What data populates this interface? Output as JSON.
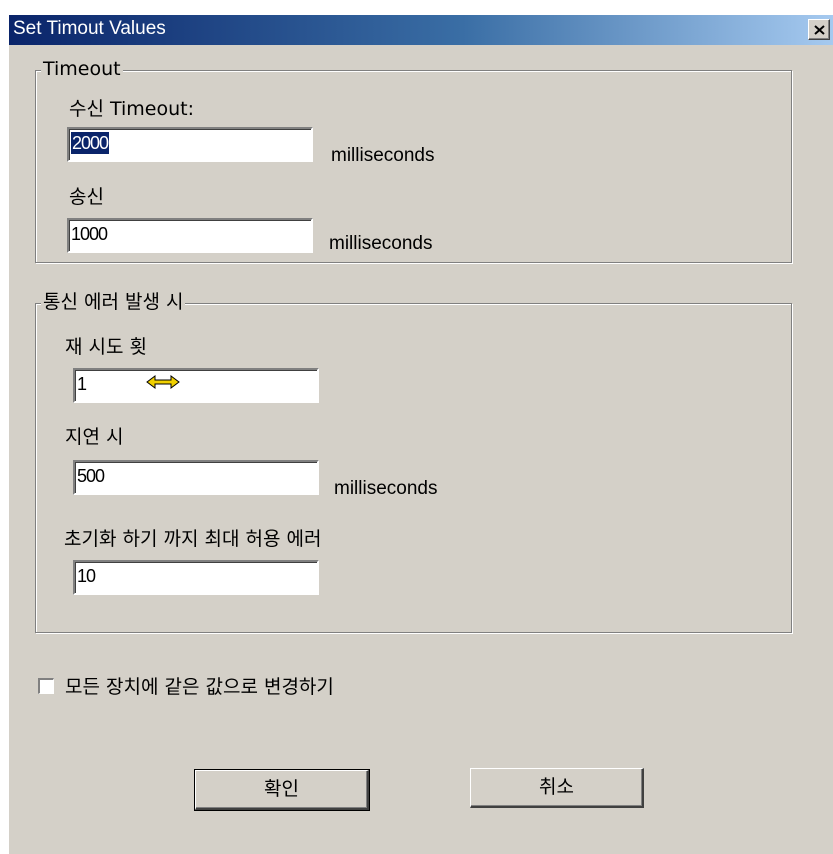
{
  "window": {
    "title": "Set Timout Values"
  },
  "timeout_group": {
    "legend": "Timeout",
    "receive_label": "수신 Timeout:",
    "receive_value": "2000",
    "receive_unit": "milliseconds",
    "send_label": "송신",
    "send_value": "1000",
    "send_unit": "milliseconds"
  },
  "error_group": {
    "legend": "통신 에러 발생 시",
    "retry_label": "재 시도 횟",
    "retry_value": "1",
    "delay_label": "지연 시",
    "delay_value": "500",
    "delay_unit": "milliseconds",
    "max_errors_label": "초기화 하기 까지 최대 허용 에러",
    "max_errors_value": "10"
  },
  "apply_all": {
    "label": "모든 장치에 같은 값으로 변경하기",
    "checked": false
  },
  "buttons": {
    "ok": "확인",
    "cancel": "취소"
  },
  "icons": {
    "close": "close-icon",
    "cursor": "resize-horizontal-cursor-icon"
  },
  "colors": {
    "face": "#d4d0c8",
    "title_start": "#0a246a",
    "title_end": "#a6caf0",
    "selection": "#0a246a"
  }
}
